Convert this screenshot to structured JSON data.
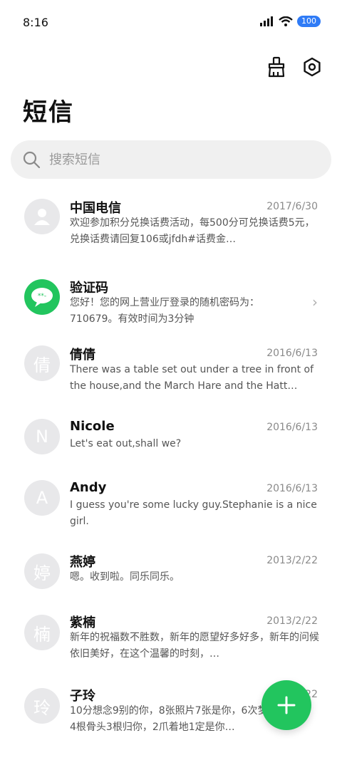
{
  "status_bar": {
    "time": "8:16",
    "battery": "100"
  },
  "header": {
    "title": "短信"
  },
  "search": {
    "placeholder": "搜索短信"
  },
  "messages": [
    {
      "avatar_text": "",
      "avatar_icon": "person-icon",
      "name": "中国电信",
      "date": "2017/6/30",
      "preview": "欢迎参加积分兑换话费活动，每500分可兑换话费5元，兑换话费请回复106或jfdh#话费金…"
    },
    {
      "avatar_text": "",
      "avatar_icon": "chat-bubble-icon",
      "name": "验证码",
      "date": "",
      "preview": "您好！您的网上营业厅登录的随机密码为：710679。有效时间为3分钟"
    },
    {
      "avatar_text": "倩",
      "avatar_icon": "",
      "name": "倩倩",
      "date": "2016/6/13",
      "preview": "There was a table set out under a tree in front of the house,and the March Hare and the Hatt…"
    },
    {
      "avatar_text": "N",
      "avatar_icon": "",
      "name": "Nicole",
      "date": "2016/6/13",
      "preview": "Let's eat out,shall we?"
    },
    {
      "avatar_text": "A",
      "avatar_icon": "",
      "name": "Andy",
      "date": "2016/6/13",
      "preview": "I guess you're some lucky guy.Stephanie is a nice girl."
    },
    {
      "avatar_text": "婷",
      "avatar_icon": "",
      "name": "燕婷",
      "date": "2013/2/22",
      "preview": "嗯。收到啦。同乐同乐。"
    },
    {
      "avatar_text": "楠",
      "avatar_icon": "",
      "name": "紫楠",
      "date": "2013/2/22",
      "preview": "新年的祝福数不胜数，新年的愿望好多好多，新年的问候依旧美好，在这个温馨的时刻，…"
    },
    {
      "avatar_text": "玲",
      "avatar_icon": "",
      "name": "子玲",
      "date": "2013/2/22",
      "preview": "10分想念9别的你，8张照片7张是你，6次梦5只像你，4根骨头3根归你，2爪着地1定是你…"
    }
  ],
  "colors": {
    "accent": "#22c55e",
    "battery": "#2f7bf6"
  }
}
